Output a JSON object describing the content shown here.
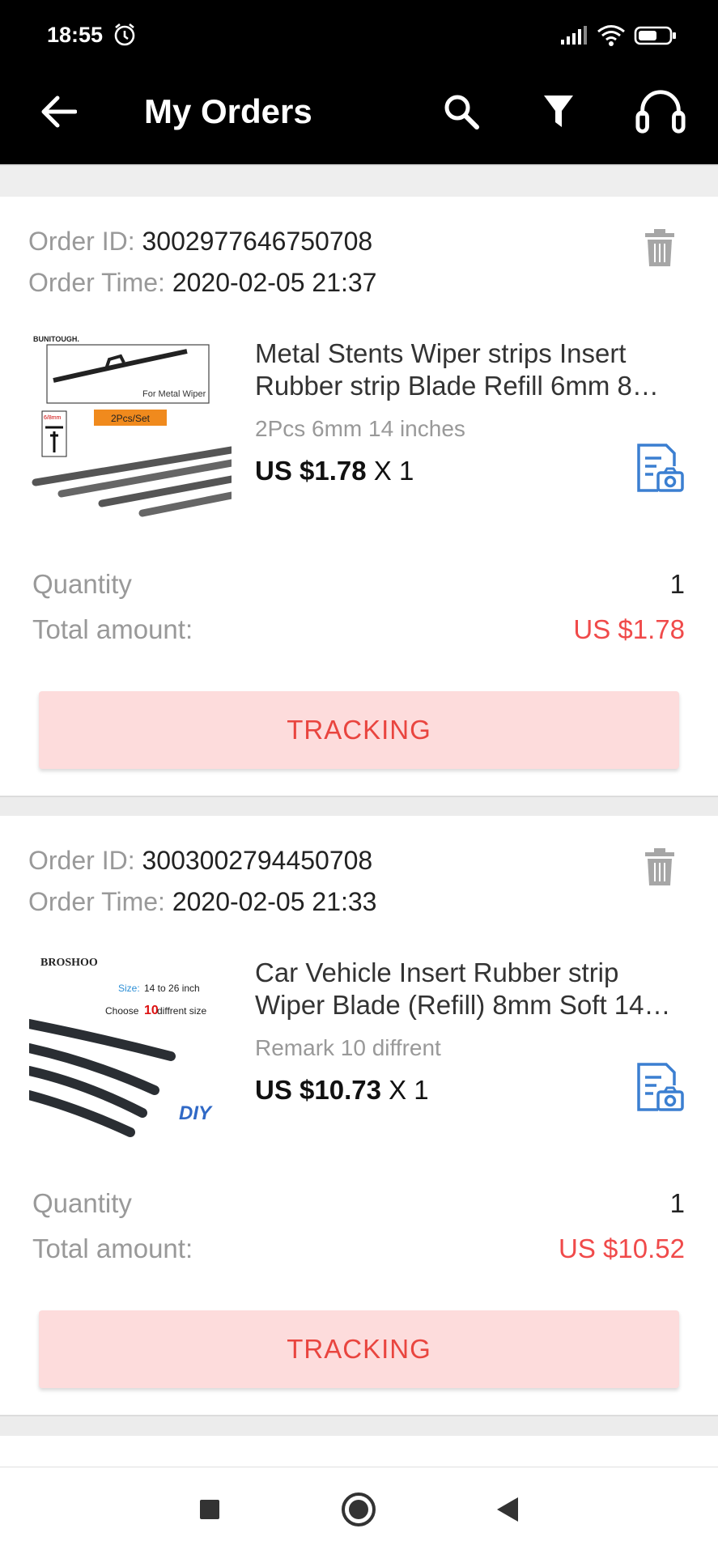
{
  "status_bar": {
    "time": "18:55",
    "icons": [
      "alarm-icon",
      "signal-icon",
      "wifi-icon",
      "battery-icon"
    ]
  },
  "app_bar": {
    "title": "My Orders",
    "actions": [
      "back-arrow-icon",
      "search-icon",
      "filter-icon",
      "headset-icon"
    ]
  },
  "orders": [
    {
      "order_id_label": "Order ID:",
      "order_id": "3002977646750708",
      "order_time_label": "Order Time:",
      "order_time": "2020-02-05 21:37",
      "product": {
        "title_line1": "Metal Stents Wiper strips Insert",
        "title_line2": "Rubber strip Blade Refill 6mm 8…",
        "sku": "2Pcs 6mm 14 inches",
        "price": "US $1.78",
        "qty_text": "X 1",
        "image_brand": "BUNITOUGH.",
        "image_caption": "For Metal Wiper",
        "image_tag": "2Pcs/Set",
        "image_size_tag": "6/8mm"
      },
      "quantity_label": "Quantity",
      "quantity": "1",
      "total_label": "Total amount:",
      "total": "US $1.78",
      "button_label": "TRACKING"
    },
    {
      "order_id_label": "Order ID:",
      "order_id": "3003002794450708",
      "order_time_label": "Order Time:",
      "order_time": "2020-02-05 21:33",
      "product": {
        "title_line1": "Car Vehicle Insert Rubber strip",
        "title_line2": "Wiper Blade (Refill) 8mm Soft 14\"…",
        "sku": "Remark 10 diffrent",
        "price": "US $10.73",
        "qty_text": "X 1",
        "image_brand": "BROSHOO",
        "image_size_label": "Size:",
        "image_size_value": "14 to 26 inch",
        "image_choose_pre": "Choose",
        "image_choose_num": "10",
        "image_choose_post": "diffrent size",
        "image_diy": "DIY"
      },
      "quantity_label": "Quantity",
      "quantity": "1",
      "total_label": "Total amount:",
      "total": "US $10.52",
      "button_label": "TRACKING"
    }
  ],
  "colors": {
    "accent_red": "#f04a4a",
    "button_bg": "#fddcdc",
    "icon_blue": "#3b7fd1"
  },
  "nav_bar": [
    "recent-apps-icon",
    "home-icon",
    "back-triangle-icon"
  ]
}
